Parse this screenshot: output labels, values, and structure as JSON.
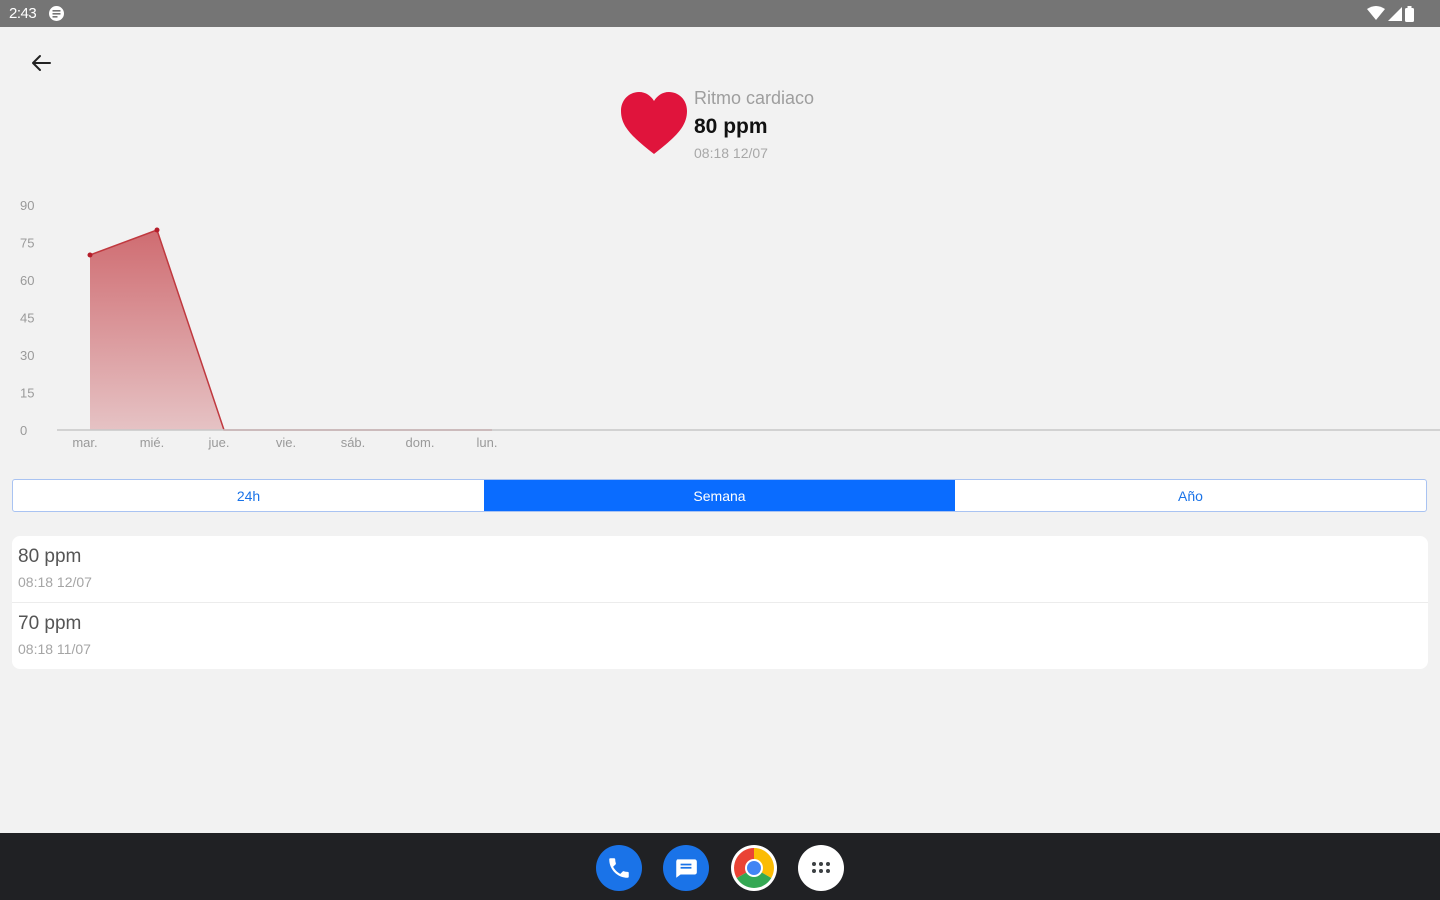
{
  "status_bar": {
    "time": "2:43"
  },
  "summary": {
    "label": "Ritmo cardiaco",
    "value": "80 ppm",
    "timestamp": "08:18 12/07",
    "heart_color": "#e0143c"
  },
  "chart_data": {
    "type": "area",
    "x": [
      "mar.",
      "mié.",
      "jue.",
      "vie.",
      "sáb.",
      "dom.",
      "lun."
    ],
    "values": [
      70,
      80,
      0,
      0,
      0,
      0,
      0
    ],
    "y_ticks": [
      0,
      15,
      30,
      45,
      60,
      75,
      90
    ],
    "ylim": [
      0,
      90
    ],
    "color": "#c9545a",
    "grid": false
  },
  "range_tabs": [
    {
      "label": "24h",
      "active": false
    },
    {
      "label": "Semana",
      "active": true
    },
    {
      "label": "Año",
      "active": false
    }
  ],
  "readings": [
    {
      "value": "80 ppm",
      "time": "08:18 12/07"
    },
    {
      "value": "70 ppm",
      "time": "08:18 11/07"
    }
  ],
  "dock": {
    "apps": [
      "phone-icon",
      "messages-icon",
      "chrome-icon",
      "app-drawer-icon"
    ]
  }
}
